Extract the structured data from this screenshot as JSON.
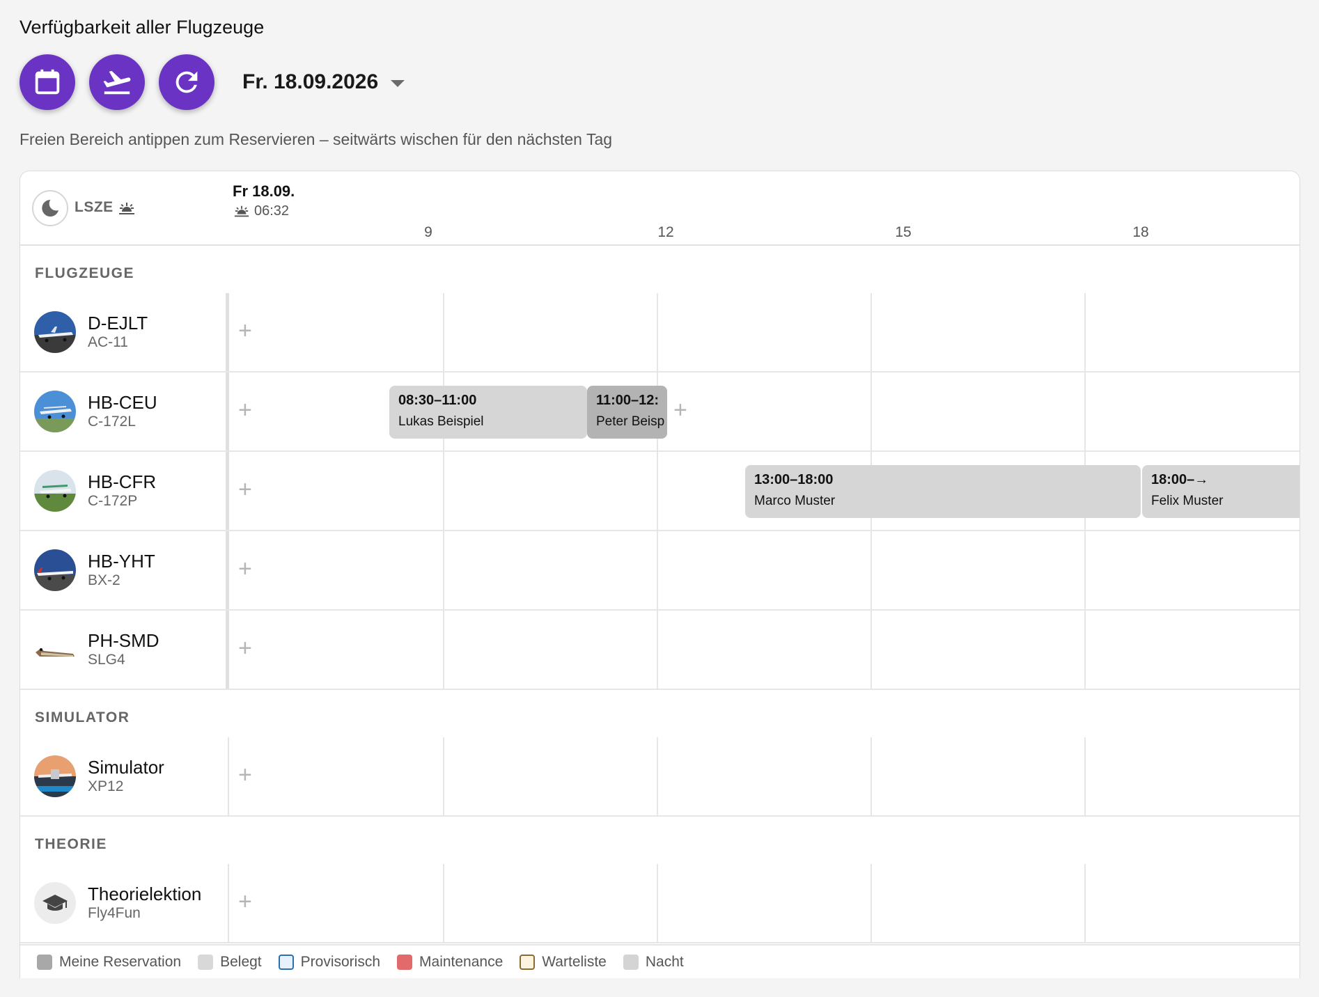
{
  "page": {
    "title": "Verfügbarkeit aller Flugzeuge",
    "hint": "Freien Bereich antippen zum Reservieren – seitwärts wischen für den nächsten Tag"
  },
  "toolbar": {
    "buttons": [
      {
        "icon": "calendar-icon"
      },
      {
        "icon": "airplane-takeoff-icon"
      },
      {
        "icon": "refresh-icon"
      }
    ],
    "date_label": "Fr. 18.09.2026",
    "accent_color": "#6b33c4"
  },
  "timeline": {
    "airport": "LSZE",
    "day_label": "Fr 18.09.",
    "sunrise": "06:32",
    "ticks": [
      "9",
      "12",
      "15",
      "18"
    ]
  },
  "sections": {
    "aircraft": "FLUGZEUGE",
    "simulator": "SIMULATOR",
    "theory": "THEORIE"
  },
  "resources": [
    {
      "name": "D-EJLT",
      "type": "AC-11"
    },
    {
      "name": "HB-CEU",
      "type": "C-172L"
    },
    {
      "name": "HB-CFR",
      "type": "C-172P"
    },
    {
      "name": "HB-YHT",
      "type": "BX-2"
    },
    {
      "name": "PH-SMD",
      "type": "SLG4"
    },
    {
      "name": "Simulator",
      "type": "XP12"
    },
    {
      "name": "Theorielektion",
      "type": "Fly4Fun"
    }
  ],
  "bookings": [
    {
      "time": "08:30–11:00",
      "name": "Lukas Beispiel",
      "status": "Belegt"
    },
    {
      "time": "11:00–12:",
      "name": "Peter Beisp",
      "status": "Meine Reservation"
    },
    {
      "time": "13:00–18:00",
      "name": "Marco Muster",
      "status": "Belegt"
    },
    {
      "time": "18:00–→",
      "name": "Felix Muster",
      "status": "Belegt"
    }
  ],
  "legend": [
    {
      "label": "Meine Reservation",
      "color": "#a8a8a8"
    },
    {
      "label": "Belegt",
      "color": "#d8d8d8"
    },
    {
      "label": "Provisorisch",
      "color": "#e6f1fb"
    },
    {
      "label": "Maintenance",
      "color": "#e26a6a"
    },
    {
      "label": "Warteliste",
      "color": "#fdf4df"
    },
    {
      "label": "Nacht",
      "color": "#d4d4d4"
    }
  ],
  "add_symbol": "+"
}
